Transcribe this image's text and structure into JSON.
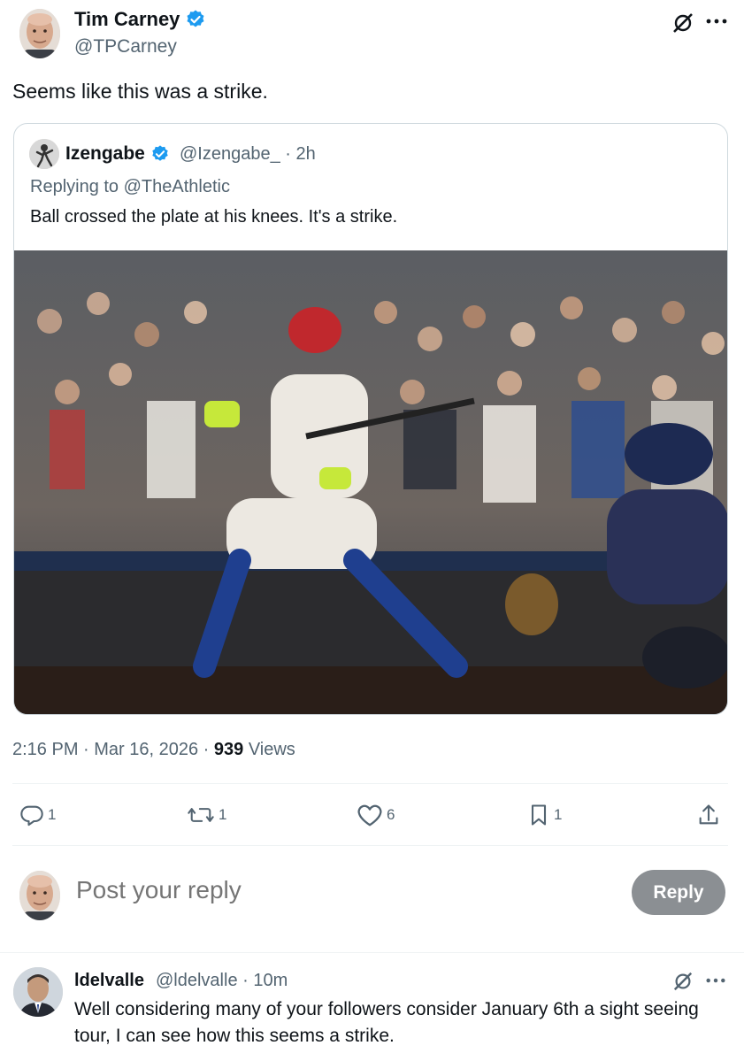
{
  "tweet": {
    "author_name": "Tim Carney",
    "author_handle": "@TPCarney",
    "text": "Seems like this was a strike.",
    "timestamp": "2:16 PM · Mar 16, 2026 · ",
    "views_count": "939",
    "views_label": " Views"
  },
  "quote": {
    "author_name": "Izengabe",
    "meta": "@Izengabe_ · 2h",
    "replying_to": "Replying to @TheAthletic",
    "text": "Ball crossed the plate at his knees. It's a strike."
  },
  "actions": {
    "replies": "1",
    "reposts": "1",
    "likes": "6",
    "bookmarks": "1"
  },
  "composer": {
    "placeholder": "Post your reply",
    "button_label": "Reply"
  },
  "reply": {
    "author_name": "ldelvalle",
    "meta": "@ldelvalle · 10m",
    "text": "Well considering many of your followers consider January 6th a sight seeing tour, I can see how this seems a strike."
  },
  "colors": {
    "verified": "#1d9bf0",
    "secondary_text": "#536471",
    "reply_button": "#8b8f93"
  },
  "icons": [
    "verified-badge-icon",
    "grok-icon",
    "more-icon",
    "reply-icon",
    "repost-icon",
    "like-icon",
    "bookmark-icon",
    "share-icon"
  ]
}
